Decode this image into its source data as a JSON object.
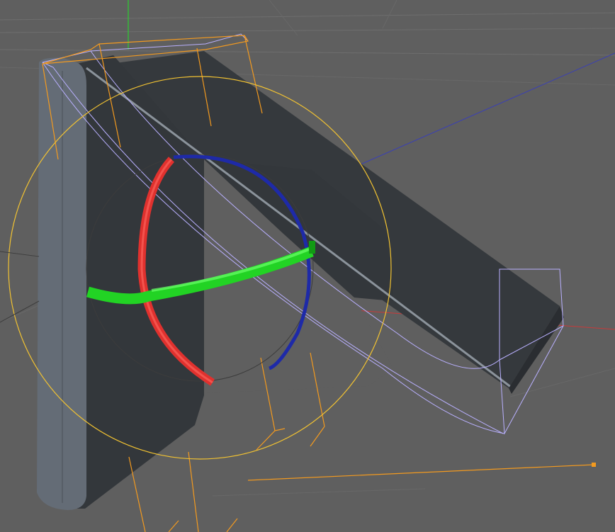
{
  "app": {
    "view": "3D viewport",
    "mode": "rotate"
  },
  "colors": {
    "background": "#5f5f5f",
    "object_dark": "#33373b",
    "object_light": "#646c76",
    "bounding_box": "#b9b0ff",
    "selection_circle": "#f1c232",
    "light_handles": "#f39a1f",
    "axis_x": "#e0312e",
    "axis_y": "#2ee032",
    "axis_z": "#1e2aa8"
  },
  "icons": {
    "rotation_gizmo": "rotate-gizmo-icon",
    "light_handle": "light-handle-icon"
  }
}
